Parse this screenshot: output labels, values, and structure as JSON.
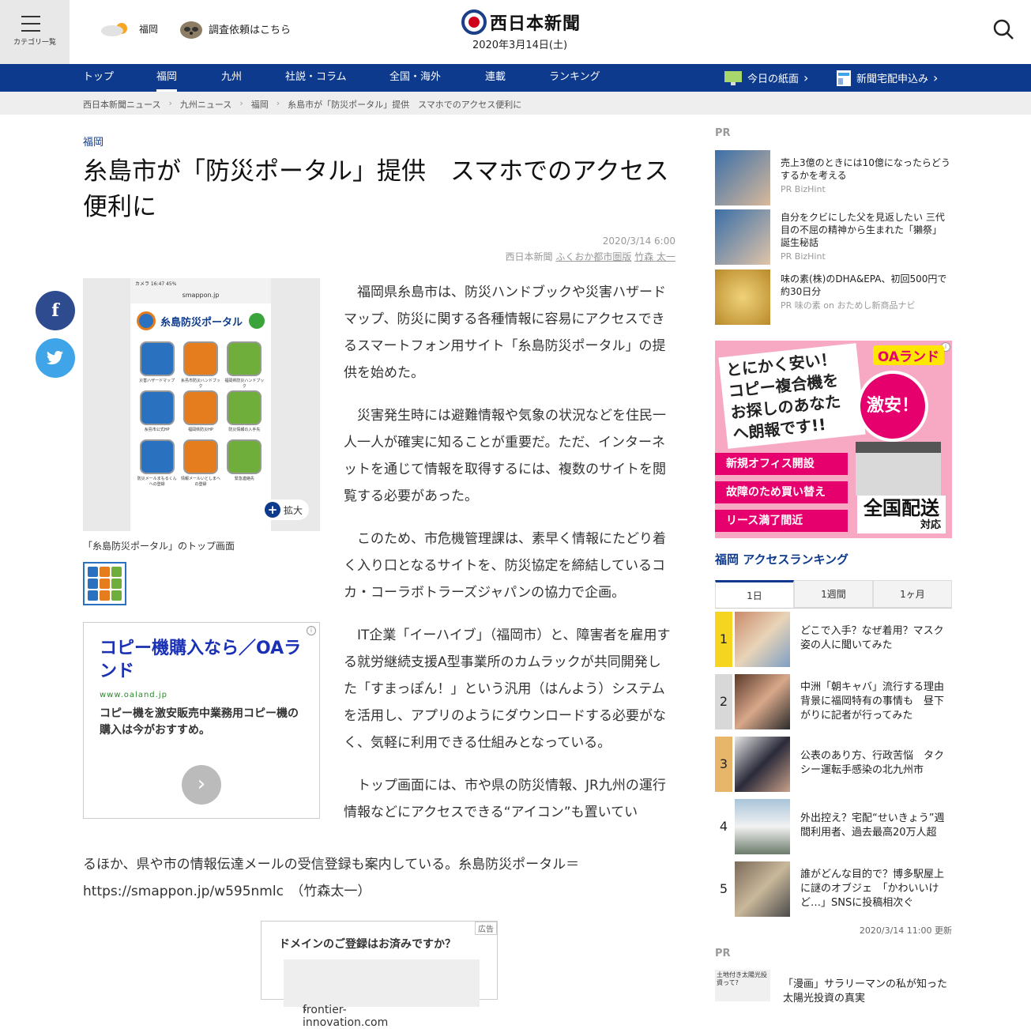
{
  "header": {
    "category_label": "カテゴリ一覧",
    "weather_city": "福岡",
    "request_label": "調査依頼はこちら",
    "logo": "西日本新聞",
    "date": "2020年3月14日(土)"
  },
  "nav": {
    "items": [
      "トップ",
      "福岡",
      "九州",
      "社説・コラム",
      "全国・海外",
      "連載",
      "ランキング"
    ],
    "active": "福岡",
    "today_paper": "今日の紙面",
    "subscribe": "新聞宅配申込み"
  },
  "breadcrumb": [
    "西日本新聞ニュース",
    "九州ニュース",
    "福岡",
    "糸島市が「防災ポータル」提供　スマホでのアクセス便利に"
  ],
  "article": {
    "area": "福岡",
    "title": "糸島市が「防災ポータル」提供　スマホでのアクセス便利に",
    "datetime": "2020/3/14 6:00",
    "source": "西日本新聞",
    "desk": "ふくおか都市圏版",
    "author": "竹森 太一",
    "photo_caption": "「糸島防災ポータル」のトップ画面",
    "zoom_label": "拡大",
    "paragraphs": [
      "福岡県糸島市は、防災ハンドブックや災害ハザードマップ、防災に関する各種情報に容易にアクセスできるスマートフォン用サイト「糸島防災ポータル」の提供を始めた。",
      "災害発生時には避難情報や気象の状況などを住民一人一人が確実に知ることが重要だ。ただ、インターネットを通じて情報を取得するには、複数のサイトを閲覧する必要があった。",
      "このため、市危機管理課は、素早く情報にたどり着く入り口となるサイトを、防災協定を締結しているコカ・コーラボトラーズジャパンの協力で企画。",
      "IT企業「イーハイブ」（福岡市）と、障害者を雇用する就労継続支援A型事業所のカムラックが共同開発した「すまっぽん！」という汎用（はんよう）システムを活用し、アプリのようにダウンロードする必要がなく、気軽に利用できる仕組みとなっている。"
    ],
    "last_paragraph_head": "トップ画面には、市や県の防災情報、JR九州の運行情報などにアクセスできる“アイコン”も置いてい",
    "last_paragraph_tail": "るほか、県や市の情報伝達メールの受信登録も案内している。糸島防災ポータル＝https://smappon.jp/w595nmlc　（竹森太一）"
  },
  "phone_screen": {
    "status": "カメラ 16:47 45%",
    "url": "smappon.jp",
    "portal_name": "糸島防災ポータル",
    "tiles": [
      "災害ハザードマップ",
      "糸島市防災ハンドブック",
      "福岡県防災ハンドブック",
      "糸島市公式HP",
      "福岡県防災HP",
      "防災情報の入手先",
      "防災メールまもるくんへの登録",
      "情報メールいとしまへの登録",
      "緊急連絡先"
    ]
  },
  "ads": {
    "text_ad_title": "コピー機購入なら／OAランド",
    "text_ad_url": "www.oaland.jp",
    "text_ad_desc": "コピー機を激安販売中業務用コピー機の購入は今がおすすめ。",
    "domain_ad_tag": "広告",
    "domain_ad_title": "ドメインのご登録はお済みですか？",
    "domain_ad_link": "frontier-innovation.com",
    "banner": {
      "brand": "OAランド",
      "catch": "とにかく安い！コピー複合機をお探しのあなたへ朗報です!!",
      "bubble": "激安！",
      "pills": [
        "新規オフィス開設",
        "故障のため買い替え",
        "リース満了間近"
      ],
      "free_shipping": "全国配送",
      "free_shipping_sub": "対応"
    }
  },
  "sidebar": {
    "pr_label": "PR",
    "pr_items": [
      {
        "title": "売上3億のときには10億になったらどうするかを考える",
        "sponsor": "PR BizHint"
      },
      {
        "title": "自分をクビにした父を見返したい 三代目の不屈の精神から生まれた「獺祭」誕生秘話",
        "sponsor": "PR BizHint"
      },
      {
        "title": "味の素(株)のDHA&EPA、初回500円で約30日分",
        "sponsor": "PR 味の素 on おためし新商品ナビ"
      }
    ],
    "ranking_title": "福岡 アクセスランキング",
    "ranking_tabs": [
      "1日",
      "1週間",
      "1ヶ月"
    ],
    "ranking": [
      {
        "rank": "1",
        "title": "どこで入手？なぜ着用？マスク姿の人に聞いてみた"
      },
      {
        "rank": "2",
        "title": "中洲「朝キャバ」流行する理由　背景に福岡特有の事情も　昼下がりに記者が行ってみた"
      },
      {
        "rank": "3",
        "title": "公表のあり方、行政苦悩　タクシー運転手感染の北九州市"
      },
      {
        "rank": "4",
        "title": "外出控え？宅配“せいきょう”週間利用者、過去最高20万人超"
      },
      {
        "rank": "5",
        "title": "誰がどんな目的で？博多駅屋上に謎のオブジェ　「かわいいけど…」SNSに投稿相次ぐ"
      }
    ],
    "ranking_updated": "2020/3/14 11:00 更新",
    "pr_label_2": "PR",
    "pr_last_title": "「漫画」サラリーマンの私が知った太陽光投資の真実",
    "pr_last_thumb": "土地付き太陽光投資って?"
  },
  "colors": {
    "brand_navy": "#0d3a8c",
    "logo_red": "#d0021b",
    "facebook": "#2d4b8e",
    "twitter": "#3fa5e8",
    "rank_top": "#f5d51f",
    "rank_mid": "#e8b66a"
  },
  "icons": {
    "search": "search-icon",
    "menu": "hamburger-menu-icon",
    "facebook": "facebook-icon",
    "twitter": "twitter-icon"
  }
}
